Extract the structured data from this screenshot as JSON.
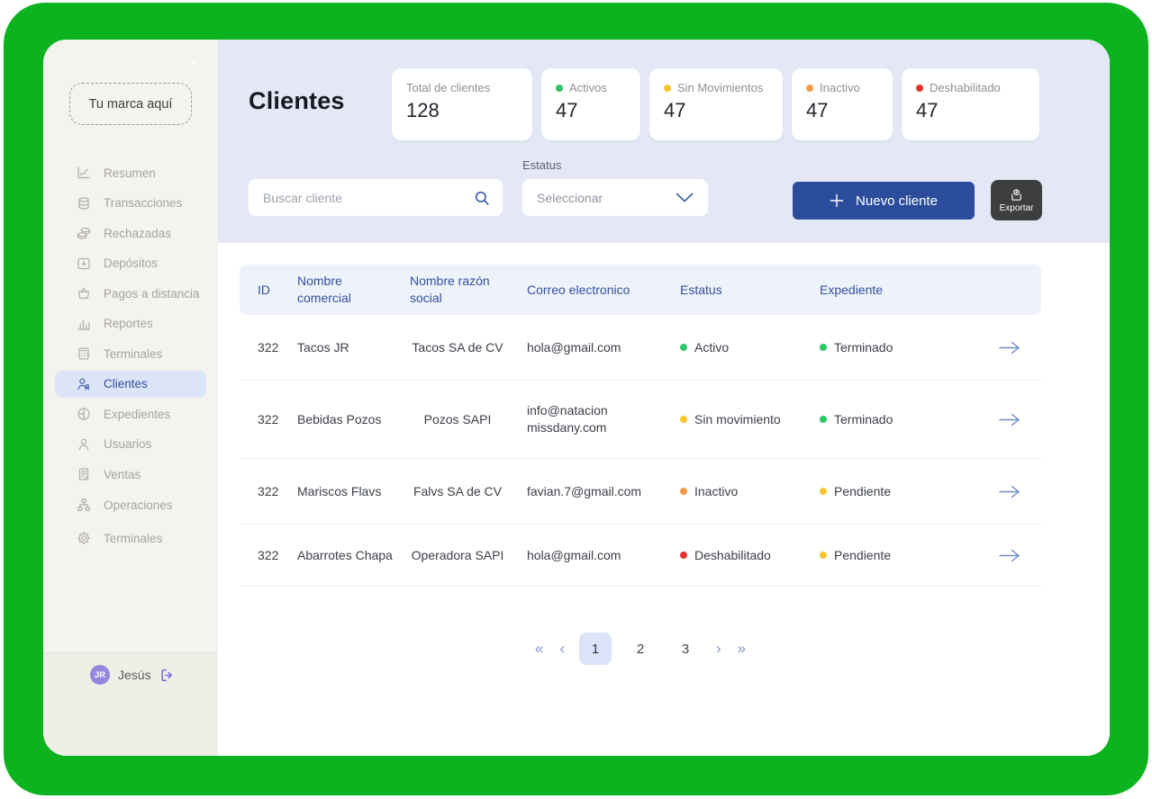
{
  "window": {
    "close_icon": "×"
  },
  "brand": {
    "label": "Tu marca aquí"
  },
  "sidebar": {
    "items": [
      {
        "label": "Resumen"
      },
      {
        "label": "Transacciones"
      },
      {
        "label": "Rechazadas"
      },
      {
        "label": "Depósitos"
      },
      {
        "label": "Pagos a distancia"
      },
      {
        "label": "Reportes"
      },
      {
        "label": "Terminales"
      },
      {
        "label": "Clientes"
      },
      {
        "label": "Expedientes"
      },
      {
        "label": "Usuarios"
      },
      {
        "label": "Ventas"
      },
      {
        "label": "Operaciones"
      },
      {
        "label": "Terminales"
      }
    ],
    "user": {
      "initials": "JR",
      "name": "Jesús"
    }
  },
  "header": {
    "title": "Clientes",
    "stats": [
      {
        "label": "Total de clientes",
        "value": "128",
        "dot_color": null
      },
      {
        "label": "Activos",
        "value": "47",
        "dot_color": "#2EC564"
      },
      {
        "label": "Sin Movimientos",
        "value": "47",
        "dot_color": "#F6C52D"
      },
      {
        "label": "Inactivo",
        "value": "47",
        "dot_color": "#F59B4C"
      },
      {
        "label": "Deshabilitado",
        "value": "47",
        "dot_color": "#E53232"
      }
    ]
  },
  "filters": {
    "search_placeholder": "Buscar cliente",
    "status_label": "Estatus",
    "status_value": "Seleccionar"
  },
  "actions": {
    "new_client": "Nuevo cliente",
    "export": "Exportar"
  },
  "table": {
    "columns": [
      "ID",
      "Nombre comercial",
      "Nombre razón social",
      "Correo electronico",
      "Estatus",
      "Expediente"
    ],
    "rows": [
      {
        "id": "322",
        "nombre_comercial": "Tacos JR",
        "razon_social": "Tacos SA de CV",
        "correo": "hola@gmail.com",
        "estatus": {
          "label": "Activo",
          "color": "#2EC564"
        },
        "expediente": {
          "label": "Terminado",
          "color": "#2EC564"
        }
      },
      {
        "id": "322",
        "nombre_comercial": "Bebidas Pozos",
        "razon_social": "Pozos SAPI",
        "correo": "info@natacion missdany.com",
        "estatus": {
          "label": "Sin movimiento",
          "color": "#F6C52D"
        },
        "expediente": {
          "label": "Terminado",
          "color": "#2EC564"
        }
      },
      {
        "id": "322",
        "nombre_comercial": "Mariscos Flavs",
        "razon_social": "Falvs SA de CV",
        "correo": "favian.7@gmail.com",
        "estatus": {
          "label": "Inactivo",
          "color": "#F59B4C"
        },
        "expediente": {
          "label": "Pendiente",
          "color": "#F6C52D"
        }
      },
      {
        "id": "322",
        "nombre_comercial": "Abarrotes Chapa",
        "razon_social": "Operadora SAPI",
        "correo": "hola@gmail.com",
        "estatus": {
          "label": "Deshabilitado",
          "color": "#E53232"
        },
        "expediente": {
          "label": "Pendiente",
          "color": "#F6C52D"
        }
      }
    ]
  },
  "pagination": {
    "first_label": "«",
    "prev_label": "‹",
    "pages": [
      "1",
      "2",
      "3"
    ],
    "active_page": "1",
    "next_label": "›",
    "last_label": "»"
  },
  "colors": {
    "frame_green": "#0cb31e",
    "header_band": "#E4E8F6",
    "sidebar_bg": "#F4F3EE",
    "accent_navy": "#33519E",
    "primary_button": "#2B4D9C",
    "export_button": "#3E3E3E",
    "active_pill": "#DCE4F8",
    "table_header_bg": "#EEF2FB"
  }
}
